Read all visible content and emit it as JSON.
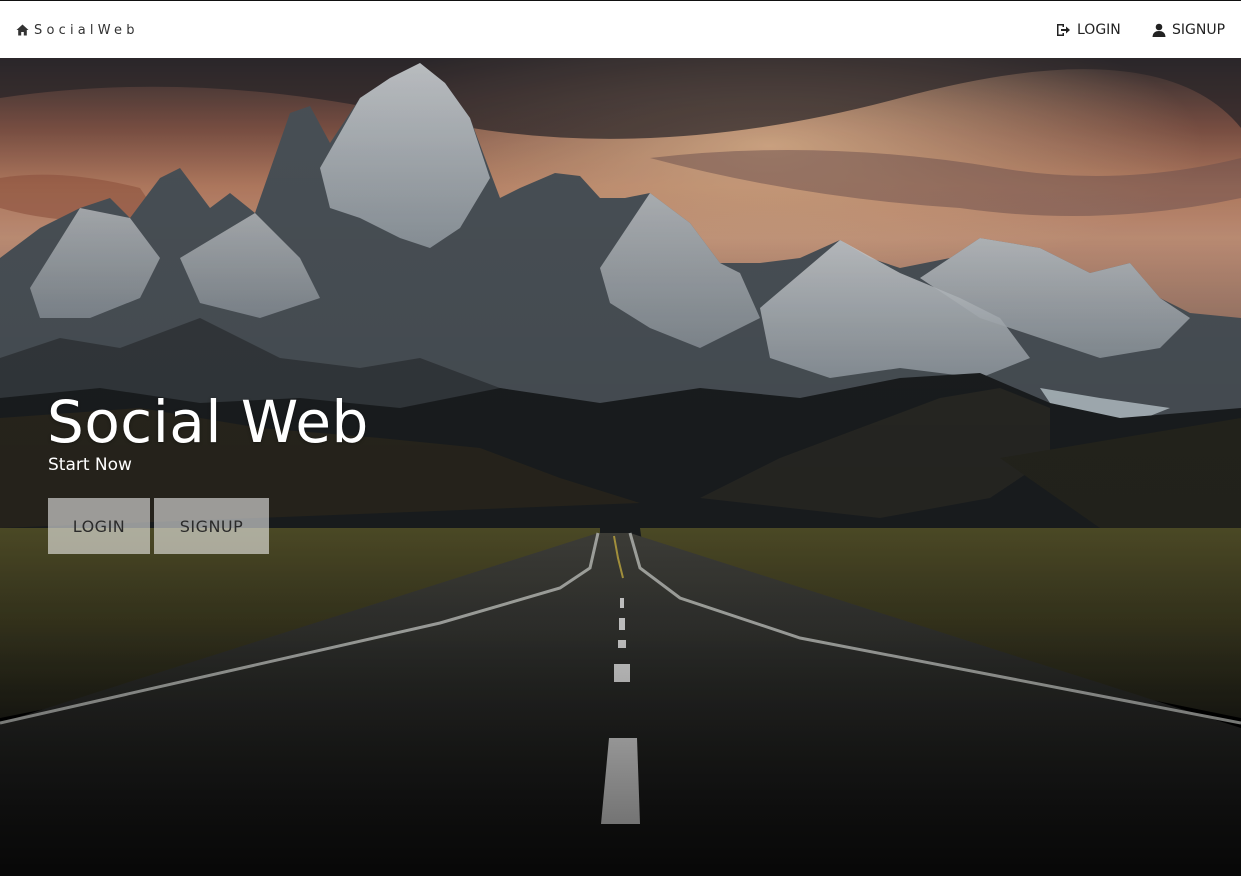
{
  "navbar": {
    "brand_label": "SocialWeb",
    "brand_icon": "home-icon",
    "login_label": "LOGIN",
    "login_icon": "log-in-icon",
    "signup_label": "SIGNUP",
    "signup_icon": "user-icon"
  },
  "hero": {
    "title": "Social Web",
    "subtitle": "Start Now",
    "login_button": "LOGIN",
    "signup_button": "SIGNUP"
  },
  "colors": {
    "navbar_bg": "#ffffff",
    "nav_text": "#222222",
    "hero_text": "#ffffff",
    "button_bg": "rgba(255,255,255,0.55)"
  }
}
